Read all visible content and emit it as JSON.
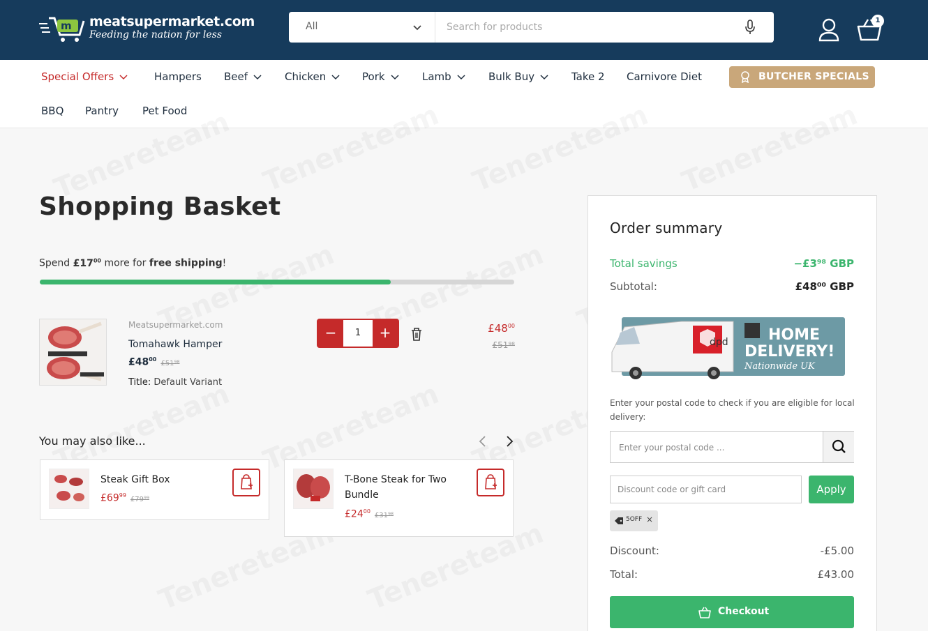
{
  "header": {
    "logo_title": "meatsupermarket.com",
    "logo_tagline": "Feeding the nation for less",
    "search_category": "All",
    "search_placeholder": "Search for products",
    "cart_count": "1"
  },
  "nav": {
    "items": [
      {
        "label": "Special Offers",
        "dropdown": true,
        "color": "#c52a2a"
      },
      {
        "label": "Hampers",
        "dropdown": false
      },
      {
        "label": "Beef",
        "dropdown": true
      },
      {
        "label": "Chicken",
        "dropdown": true
      },
      {
        "label": "Pork",
        "dropdown": true
      },
      {
        "label": "Lamb",
        "dropdown": true
      },
      {
        "label": "Bulk Buy",
        "dropdown": true
      },
      {
        "label": "Take 2",
        "dropdown": false
      },
      {
        "label": "Carnivore Diet",
        "dropdown": false
      },
      {
        "label": "BBQ",
        "dropdown": false
      },
      {
        "label": "Pantry",
        "dropdown": false
      },
      {
        "label": "Pet Food",
        "dropdown": false
      }
    ],
    "butcher_specials": "BUTCHER SPECIALS"
  },
  "basket": {
    "title": "Shopping Basket",
    "shipping": {
      "prefix": "Spend",
      "amount_main": "£17",
      "amount_sup": "00",
      "middle": "more for",
      "bold": "free shipping",
      "suffix": "!",
      "progress_fraction": 0.74
    },
    "item": {
      "vendor": "Meatsupermarket.com",
      "name": "Tomahawk Hamper",
      "price_main": "£48",
      "price_sup": "00",
      "compare": "£51⁹⁸",
      "variant_label": "Title:",
      "variant_value": "Default Variant",
      "quantity": "1",
      "line_price_main": "£48",
      "line_price_sup": "00",
      "line_compare": "£51⁹⁸"
    },
    "also_like_title": "You may also like...",
    "recommendations": [
      {
        "name": "Steak Gift Box",
        "price_main": "£69",
        "price_sup": "99",
        "compare": "£79⁹⁹"
      },
      {
        "name": "T-Bone Steak for Two Bundle",
        "price_main": "£24",
        "price_sup": "00",
        "compare": "£31⁹⁸"
      }
    ]
  },
  "summary": {
    "title": "Order summary",
    "savings_label": "Total savings",
    "savings_value": "−£3⁹⁸ GBP",
    "subtotal_label": "Subtotal:",
    "subtotal_value": "£48⁰⁰ GBP",
    "dpd_heading_1": "HOME",
    "dpd_heading_2": "DELIVERY!",
    "dpd_sub": "Nationwide UK",
    "dpd_brand": "dpd",
    "postal_text": "Enter your postal code to check if you are eligible for local delivery:",
    "postal_placeholder": "Enter your postal code ...",
    "discount_placeholder": "Discount code or gift card",
    "apply_label": "Apply",
    "applied_code": "5OFF",
    "discount_label": "Discount:",
    "discount_value": "-£5.00",
    "total_label": "Total:",
    "total_value": "£43.00",
    "checkout_label": "Checkout"
  },
  "watermark": "Tenereteam",
  "colors": {
    "header_bg": "#163b5c",
    "accent_red": "#c52a2a",
    "accent_green": "#3bb56d",
    "butcher_gold": "#c9a77a"
  }
}
